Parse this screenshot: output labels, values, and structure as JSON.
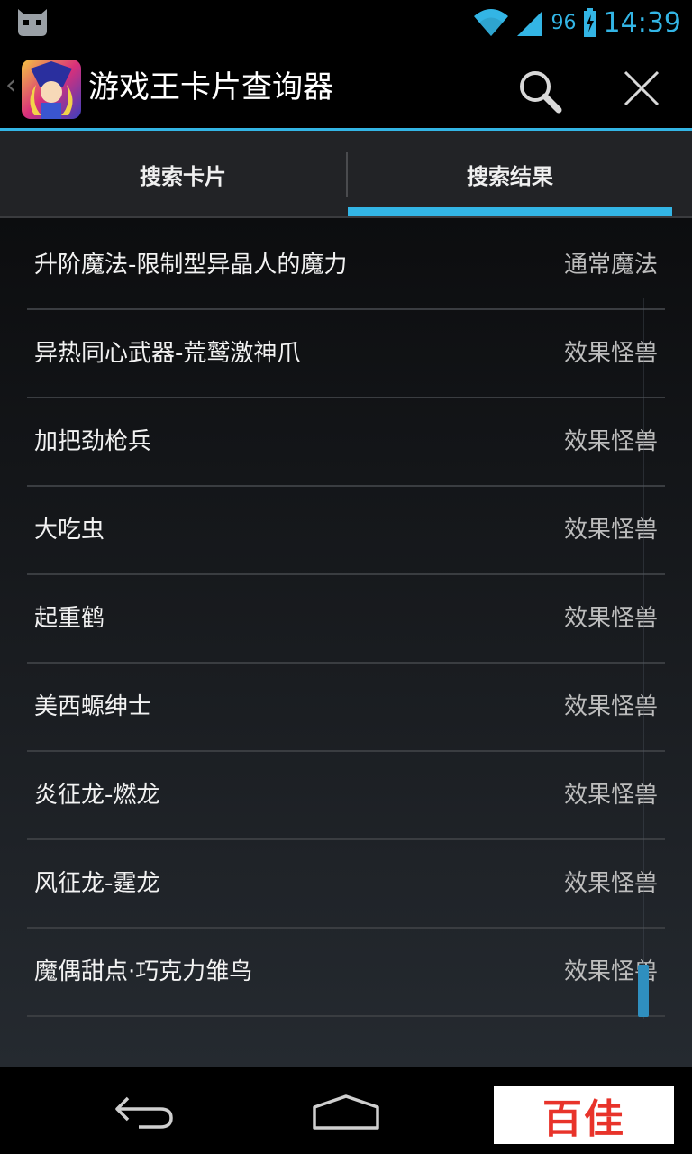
{
  "status_bar": {
    "battery_level": "96",
    "time": "14:39",
    "icons": [
      "cyanogenmod-mascot-icon",
      "wifi-icon",
      "signal-icon",
      "battery-icon"
    ],
    "accent_color": "#33b5e5"
  },
  "action_bar": {
    "title": "游戏王卡片查询器",
    "icons": [
      "up-chevron-icon",
      "app-logo-icon",
      "search-icon",
      "close-icon"
    ]
  },
  "tabs": [
    {
      "label": "搜索卡片",
      "selected": false
    },
    {
      "label": "搜索结果",
      "selected": true
    }
  ],
  "results": [
    {
      "name": "升阶魔法-限制型异晶人的魔力",
      "type": "通常魔法"
    },
    {
      "name": "异热同心武器-荒鹫激神爪",
      "type": "效果怪兽"
    },
    {
      "name": "加把劲枪兵",
      "type": "效果怪兽"
    },
    {
      "name": "大吃虫",
      "type": "效果怪兽"
    },
    {
      "name": "起重鹤",
      "type": "效果怪兽"
    },
    {
      "name": "美西螈绅士",
      "type": "效果怪兽"
    },
    {
      "name": "炎征龙-燃龙",
      "type": "效果怪兽"
    },
    {
      "name": "风征龙-霆龙",
      "type": "效果怪兽"
    },
    {
      "name": "魔偶甜点·巧克力雏鸟",
      "type": "效果怪兽"
    }
  ],
  "nav_bar": {
    "icons": [
      "back-icon",
      "home-icon"
    ],
    "watermark_text": "百佳"
  }
}
